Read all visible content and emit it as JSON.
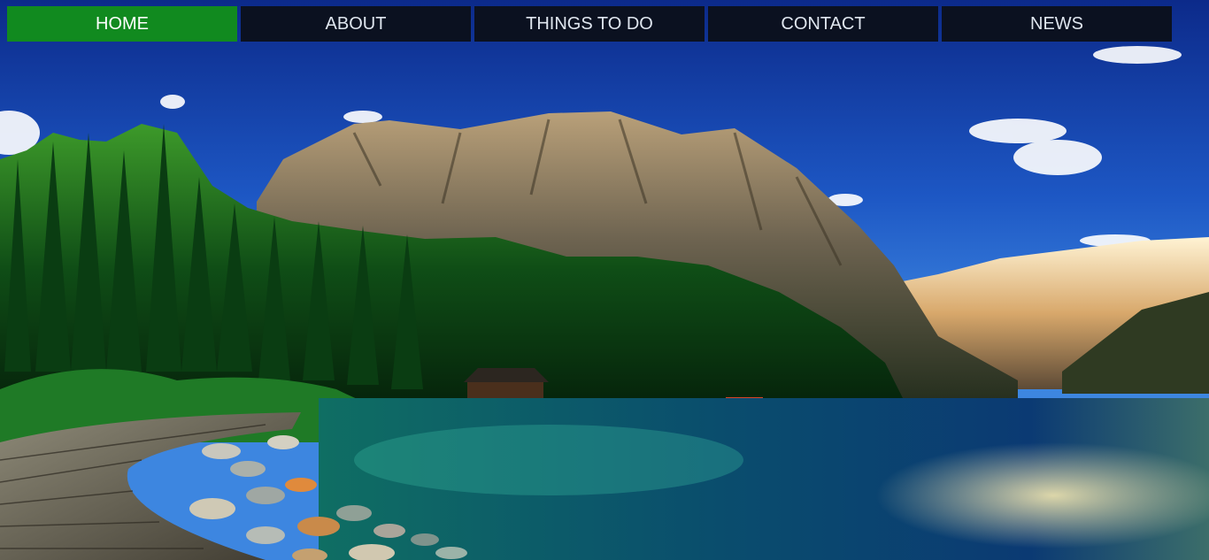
{
  "nav": {
    "items": [
      {
        "label": "HOME",
        "active": true
      },
      {
        "label": "ABOUT",
        "active": false
      },
      {
        "label": "THINGS TO DO",
        "active": false
      },
      {
        "label": "CONTACT",
        "active": false
      },
      {
        "label": "NEWS",
        "active": false
      }
    ],
    "active_color": "#118a1f",
    "bg_color": "#0b1120"
  },
  "hero": {
    "image": "mountain-lake-landscape"
  }
}
